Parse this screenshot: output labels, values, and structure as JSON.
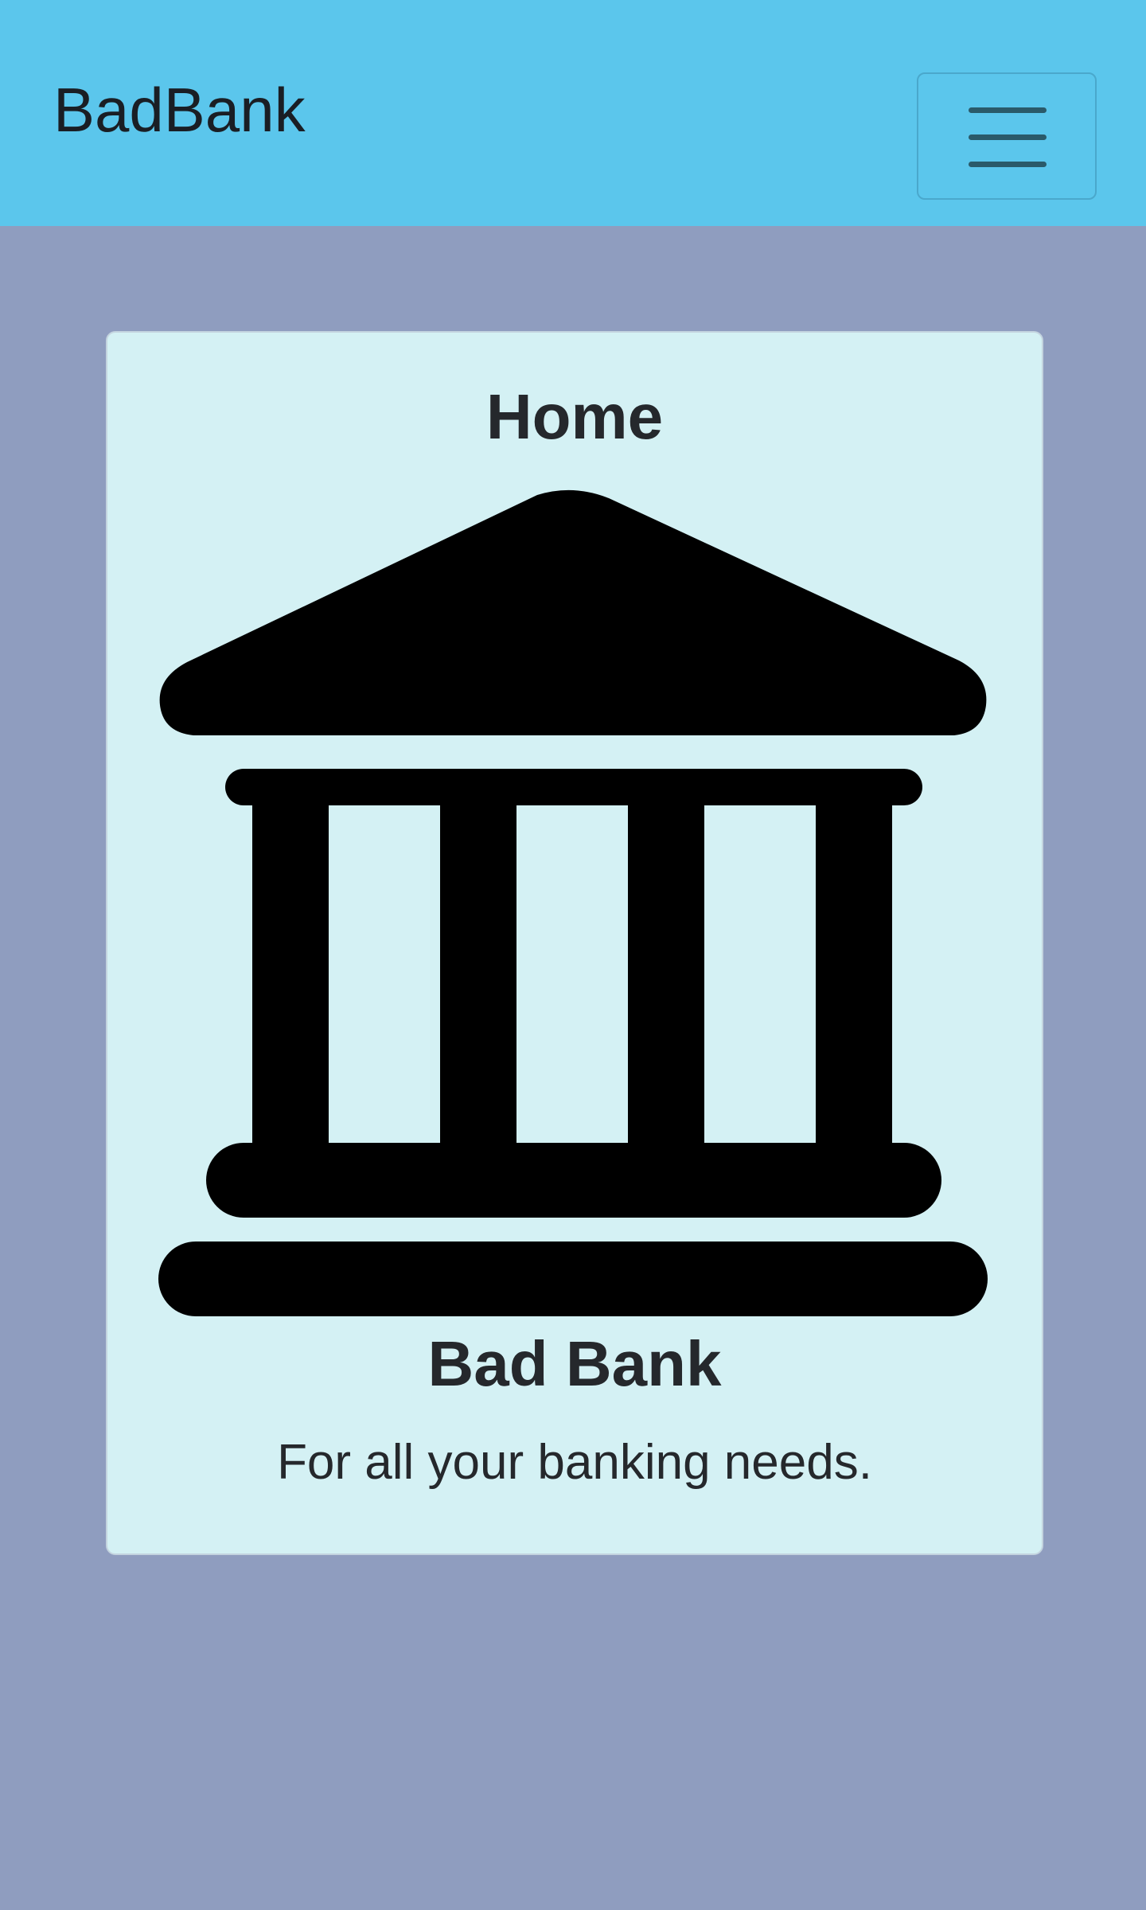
{
  "navbar": {
    "brand": "BadBank",
    "background": "#5bc6ec",
    "toggler_icon": "hamburger-menu-icon"
  },
  "page": {
    "background": "#8f9dbf"
  },
  "card": {
    "header": "Home",
    "image_icon": "bank-building-icon",
    "title": "Bad Bank",
    "text": "For all your banking needs.",
    "background": "#d4f1f4"
  }
}
